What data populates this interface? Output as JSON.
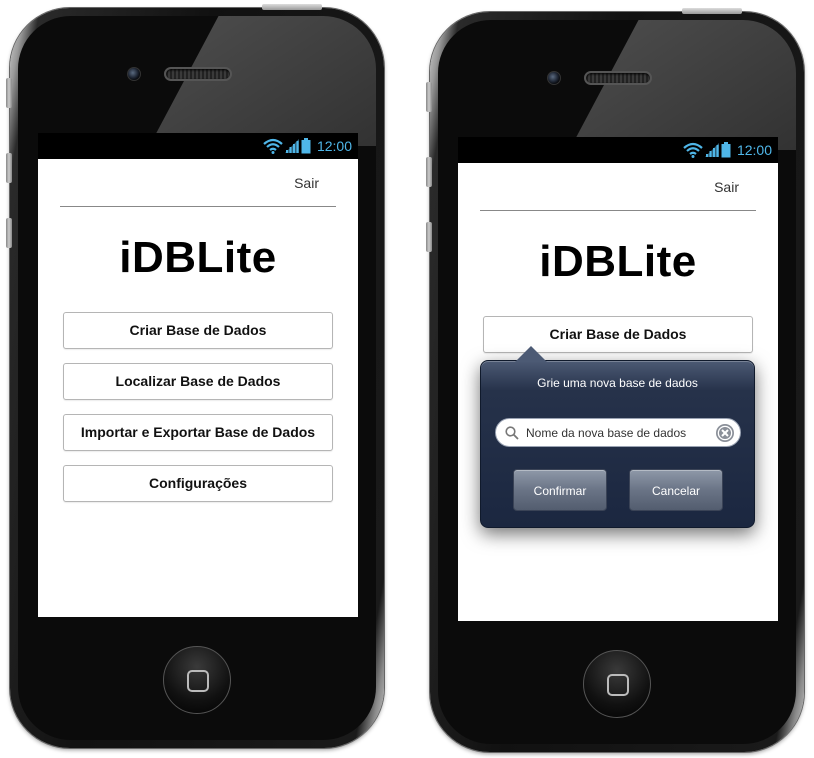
{
  "status": {
    "time": "12:00"
  },
  "left_screen": {
    "topbar": {
      "sair": "Sair"
    },
    "app_title": "iDBLite",
    "menu": [
      {
        "label": "Criar Base de Dados"
      },
      {
        "label": "Localizar Base de Dados"
      },
      {
        "label": "Importar e Exportar Base de Dados"
      },
      {
        "label": "Configurações"
      }
    ]
  },
  "right_screen": {
    "topbar": {
      "sair": "Sair"
    },
    "app_title": "iDBLite",
    "menu": [
      {
        "label": "Criar Base de Dados"
      }
    ],
    "popover": {
      "title": "Grie uma nova base de dados",
      "input_placeholder": "Nome da nova base de dados",
      "input_value": "",
      "confirm_label": "Confirmar",
      "cancel_label": "Cancelar"
    }
  },
  "colors": {
    "status_icon": "#4fb6e8",
    "popover_bg": "#1b2740",
    "popover_button": "#6a7486"
  }
}
